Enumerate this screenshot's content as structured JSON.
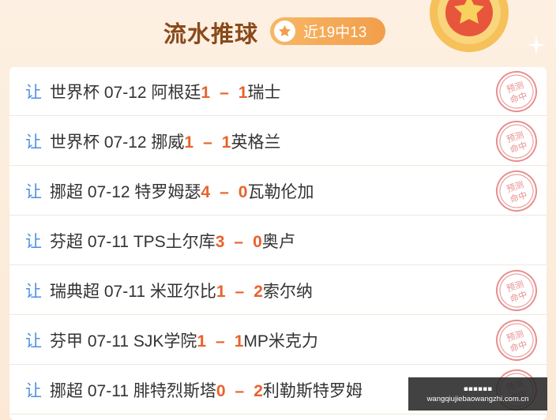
{
  "header": {
    "title": "流水推球",
    "hit_label": "近19中13"
  },
  "colors": {
    "accent_orange": "#e8622c",
    "rang_blue": "#4a8fe0",
    "stamp_red": "#e06a6a"
  },
  "rows": [
    {
      "rang": "让",
      "league": "世界杯",
      "date": "07-12",
      "home": "阿根廷",
      "home_score": "1",
      "away_score": "1",
      "away": "瑞士",
      "stamp": "预测命中"
    },
    {
      "rang": "让",
      "league": "世界杯",
      "date": "07-12",
      "home": "挪威",
      "home_score": "1",
      "away_score": "1",
      "away": "英格兰",
      "stamp": "预测命中"
    },
    {
      "rang": "让",
      "league": "挪超",
      "date": "07-12",
      "home": "特罗姆瑟",
      "home_score": "4",
      "away_score": "0",
      "away": "瓦勒伦加",
      "stamp": "预测命中"
    },
    {
      "rang": "让",
      "league": "芬超",
      "date": "07-11",
      "home": "TPS土尔库",
      "home_score": "3",
      "away_score": "0",
      "away": "奥卢",
      "stamp": ""
    },
    {
      "rang": "让",
      "league": "瑞典超",
      "date": "07-11",
      "home": "米亚尔比",
      "home_score": "1",
      "away_score": "2",
      "away": "索尔纳",
      "stamp": "预测命中"
    },
    {
      "rang": "让",
      "league": "芬甲",
      "date": "07-11",
      "home": "SJK学院",
      "home_score": "1",
      "away_score": "1",
      "away": "MP米克力",
      "stamp": "预测命中"
    },
    {
      "rang": "让",
      "league": "挪超",
      "date": "07-11",
      "home": "腓特烈斯塔",
      "home_score": "0",
      "away_score": "2",
      "away": "利勒斯特罗姆",
      "stamp": "预测命中"
    }
  ],
  "footer": {
    "line1": "▪▪▪▪▪▪",
    "line2": "wangqiujiebaowangzhi.com.cn"
  }
}
